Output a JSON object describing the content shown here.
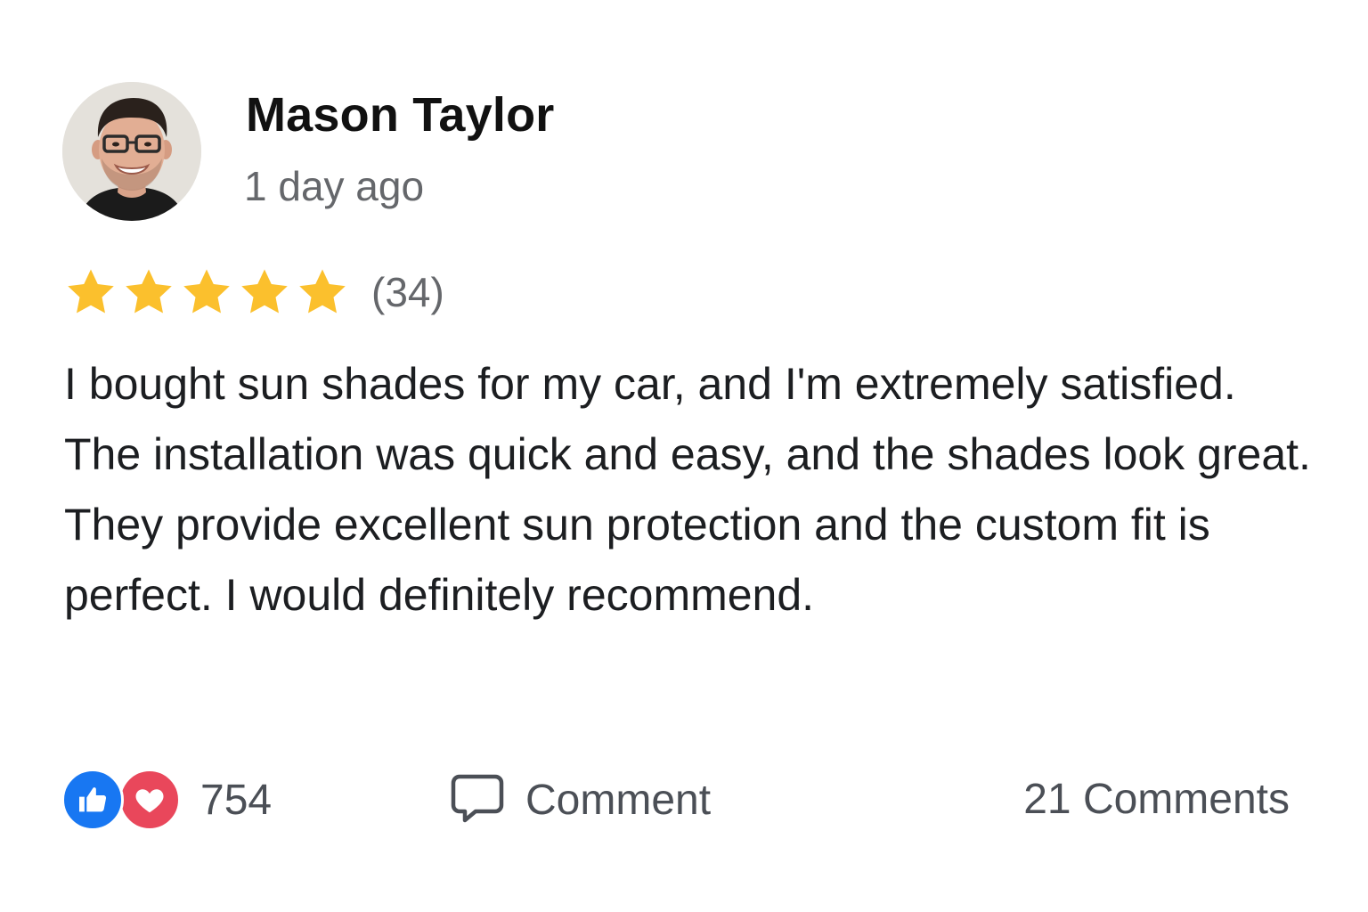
{
  "review": {
    "author": "Mason Taylor",
    "timestamp": "1 day ago",
    "rating": {
      "stars": 5,
      "max": 5,
      "count_label": "(34)",
      "star_color": "#fbc02d"
    },
    "text": "I bought sun shades for my car, and I'm extremely satisfied. The installation was quick and easy, and the shades look great. They provide excellent sun protection and the custom fit is perfect. I would definitely recommend."
  },
  "footer": {
    "reactions": {
      "icons": [
        "thumbs-up-icon",
        "heart-icon"
      ],
      "like_color": "#1877f2",
      "love_color": "#e9475b",
      "count": "754"
    },
    "comment_button": {
      "icon": "comment-bubble-icon",
      "label": "Comment"
    },
    "comments_count": "21 Comments"
  }
}
